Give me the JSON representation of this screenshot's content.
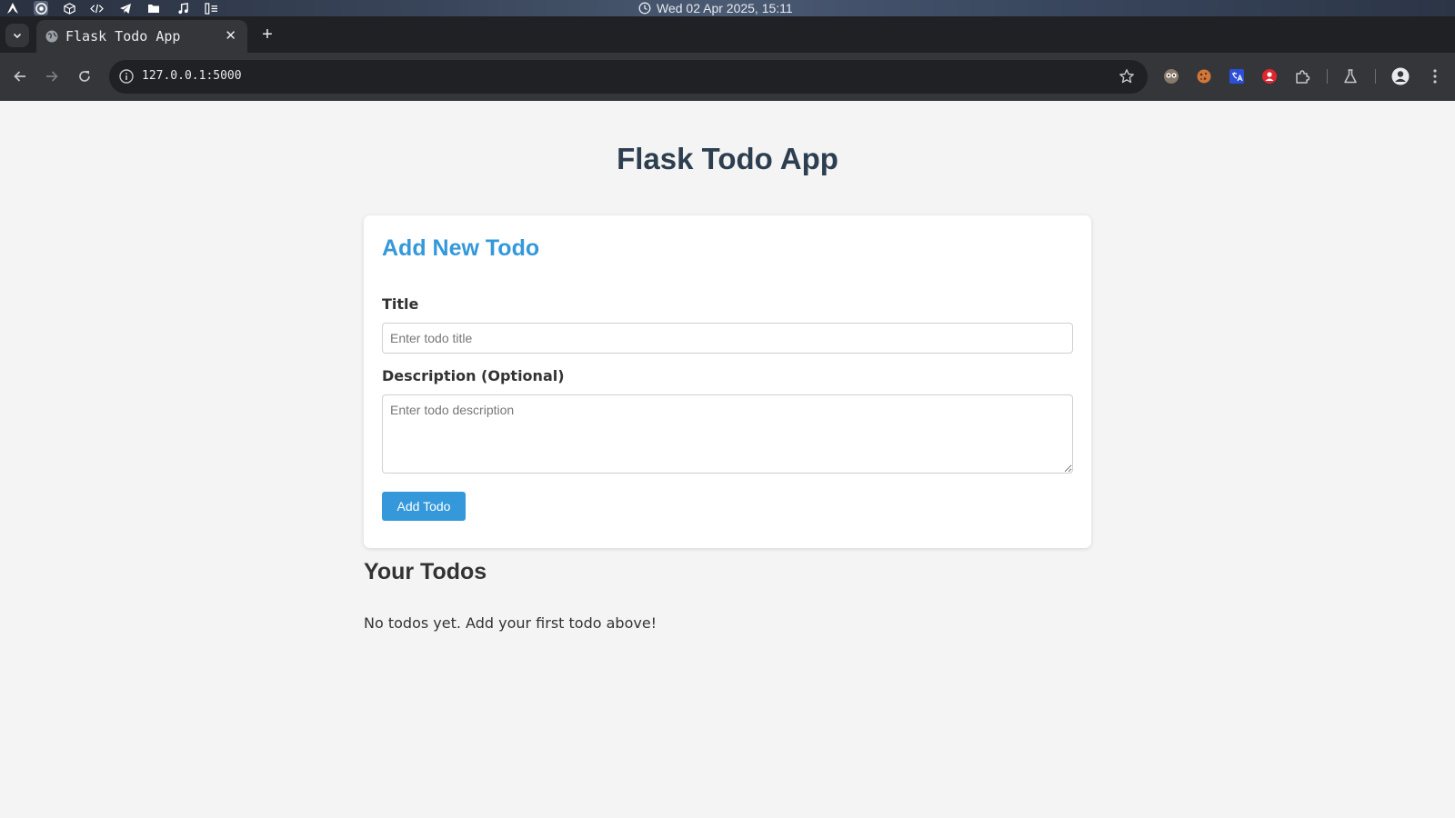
{
  "os": {
    "clock_text": "Wed 02 Apr 2025, 15:11",
    "launcher_icons": [
      "arch-logo-icon",
      "chrome-icon",
      "cube-icon",
      "code-icon",
      "telegram-icon",
      "folder-icon",
      "music-icon",
      "window-layout-icon"
    ]
  },
  "browser": {
    "tab_title": "Flask Todo App",
    "close_glyph": "✕",
    "new_tab_glyph": "+",
    "url": "127.0.0.1:5000"
  },
  "app": {
    "title": "Flask Todo App",
    "form": {
      "heading": "Add New Todo",
      "title_label": "Title",
      "title_placeholder": "Enter todo title",
      "title_value": "",
      "description_label": "Description (Optional)",
      "description_placeholder": "Enter todo description",
      "description_value": "",
      "submit_label": "Add Todo"
    },
    "todos": {
      "heading": "Your Todos",
      "empty_message": "No todos yet. Add your first todo above!",
      "items": []
    }
  },
  "colors": {
    "accent": "#3498db",
    "heading": "#2c3e50",
    "page_bg": "#f4f4f4",
    "browser_chrome": "#35363a",
    "tab_strip": "#202124"
  }
}
